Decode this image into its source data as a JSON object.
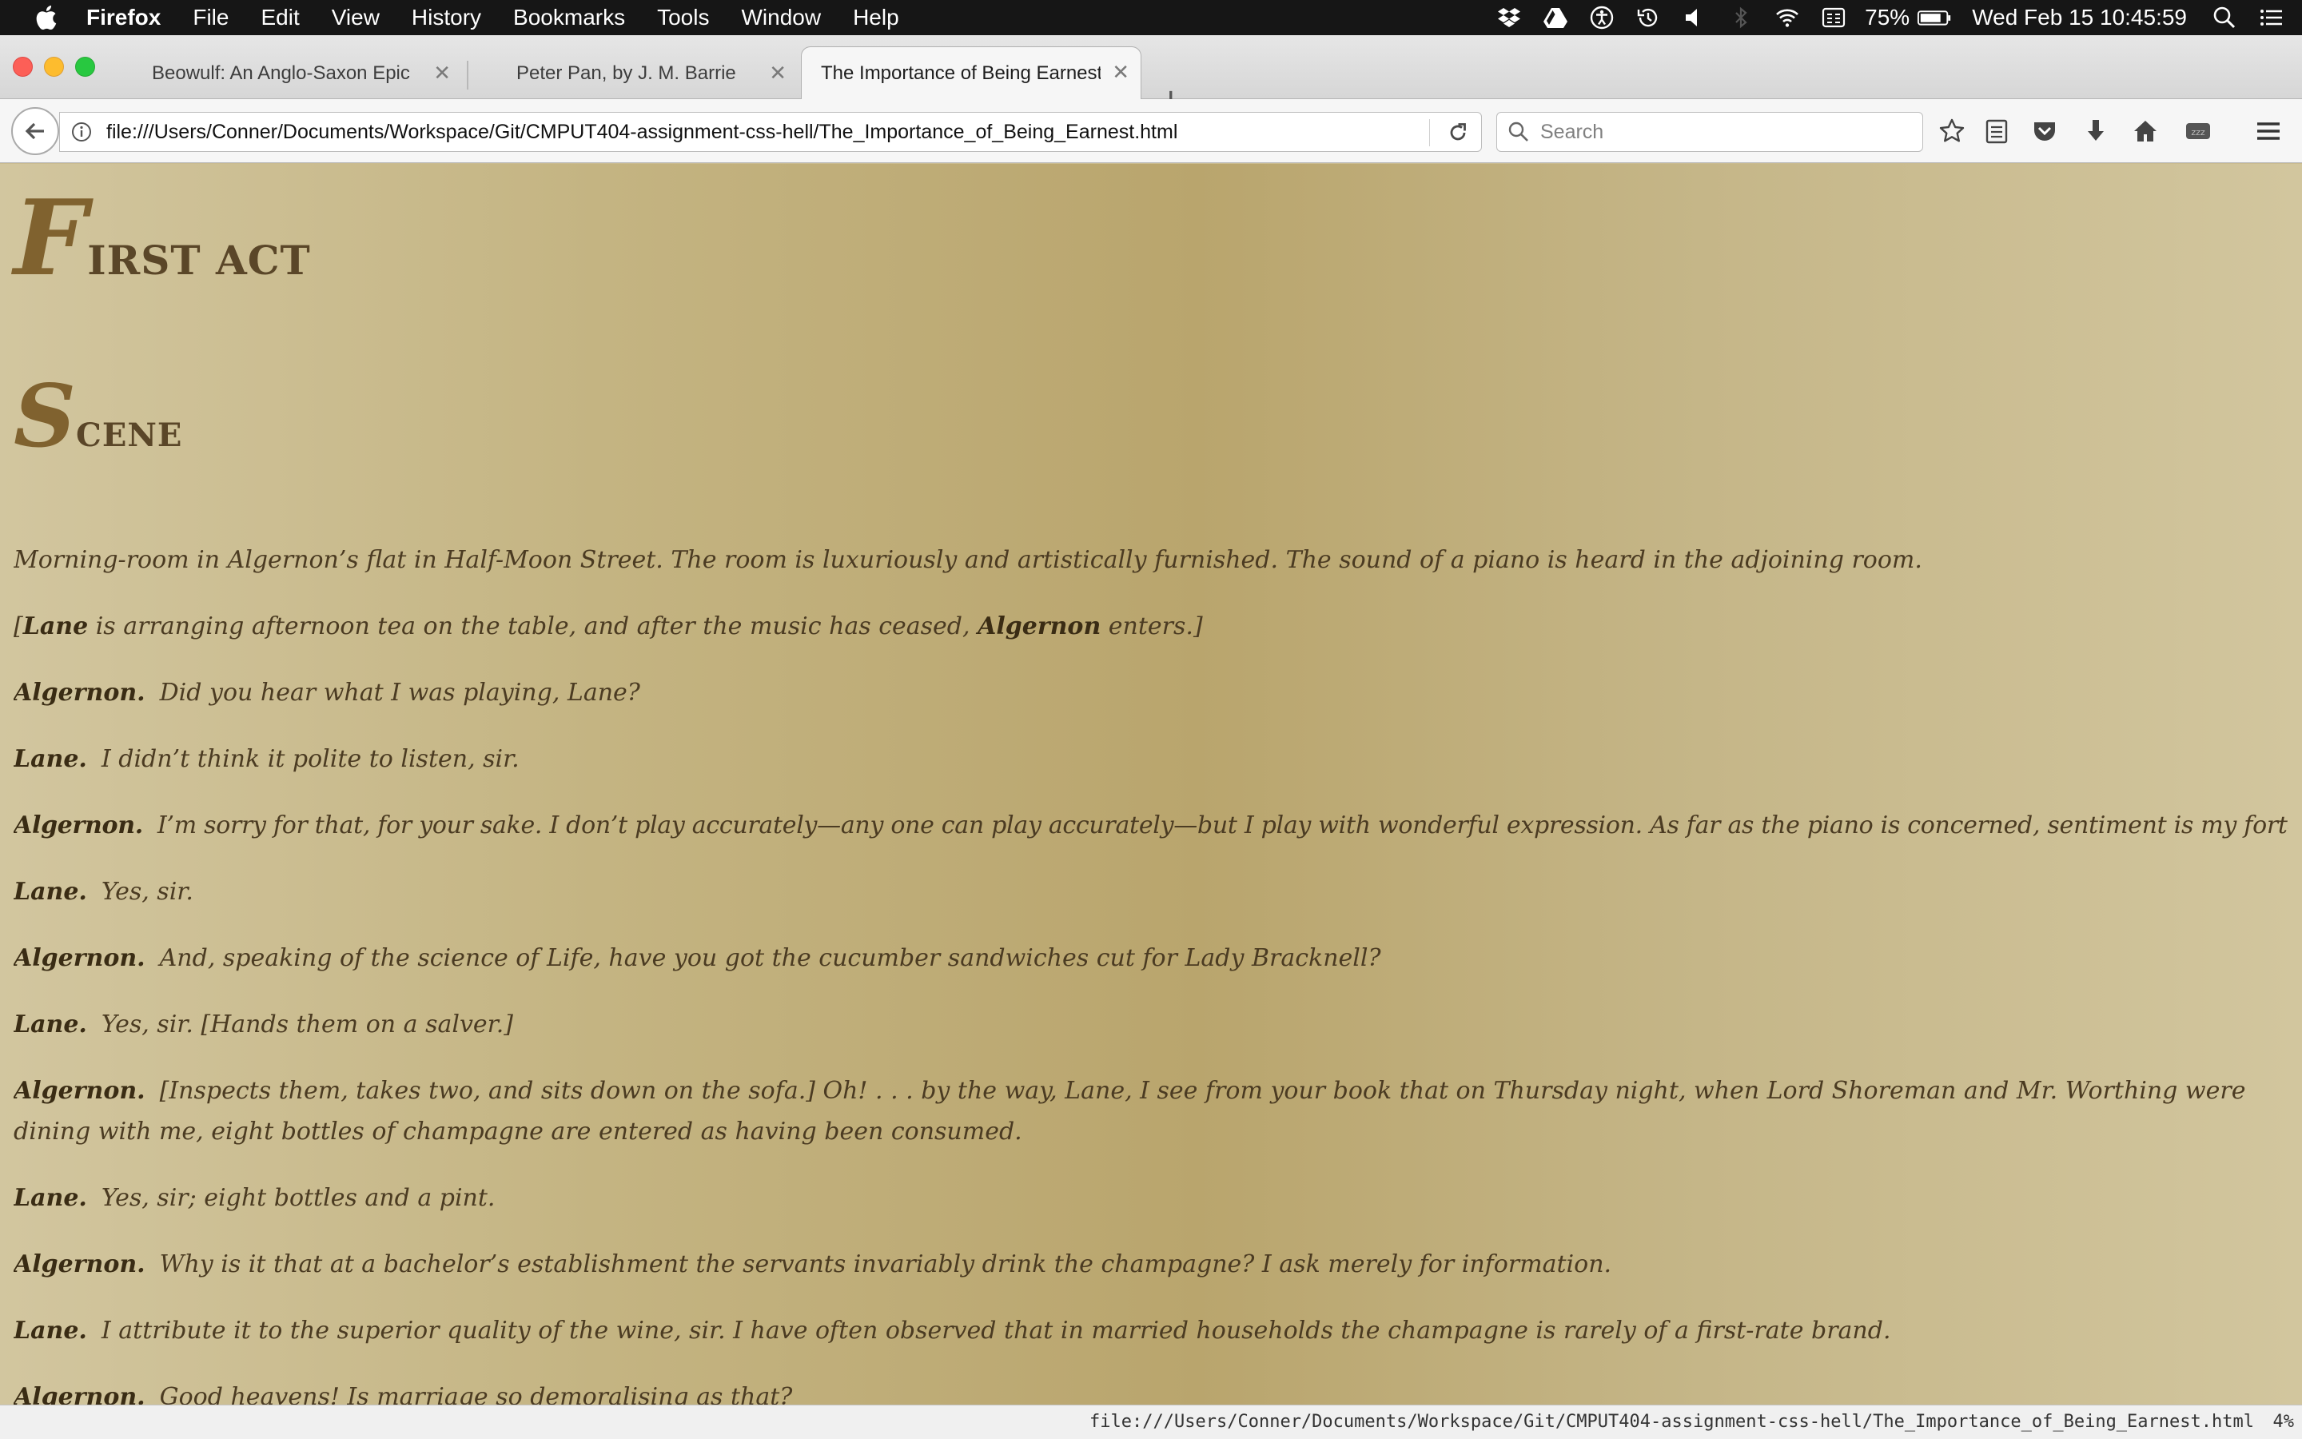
{
  "menubar": {
    "app_name": "Firefox",
    "items": [
      "File",
      "Edit",
      "View",
      "History",
      "Bookmarks",
      "Tools",
      "Window",
      "Help"
    ],
    "battery": "75%",
    "datetime": "Wed Feb 15  10:45:59"
  },
  "tabs": [
    {
      "title": "Beowulf: An Anglo-Saxon Epic ...",
      "active": false
    },
    {
      "title": "Peter Pan, by J. M. Barrie",
      "active": false
    },
    {
      "title": "The Importance of Being Earnest",
      "active": true
    }
  ],
  "toolbar": {
    "url": "file:///Users/Conner/Documents/Workspace/Git/CMPUT404-assignment-css-hell/The_Importance_of_Being_Earnest.html",
    "search_placeholder": "Search"
  },
  "page": {
    "act_initial": "F",
    "act_rest": "irst act",
    "scene_initial": "S",
    "scene_rest": "cene",
    "stage_direction": "Morning-room in Algernon’s flat in Half-Moon Street.  The room is luxuriously and artistically furnished.  The sound of a piano is heard in the adjoining room.",
    "entrance": {
      "open": "[",
      "name1": "Lane",
      "middle": " is arranging afternoon tea on the table, and after the music has ceased, ",
      "name2": "Algernon",
      "close": " enters.]"
    },
    "dialogue": [
      {
        "speaker": "Algernon.",
        "line": "Did you hear what I was playing, Lane?"
      },
      {
        "speaker": "Lane.",
        "line": "I didn’t think it polite to listen, sir."
      },
      {
        "speaker": "Algernon.",
        "line": "I’m sorry for that, for your sake.  I don’t play accurately—any one can play accurately—but I play with wonderful expression.  As far as the piano is concerned, sentiment is my forte.  I keep science for Life."
      },
      {
        "speaker": "Lane.",
        "line": "Yes, sir."
      },
      {
        "speaker": "Algernon.",
        "line": "And, speaking of the science of Life, have you got the cucumber sandwiches cut for Lady Bracknell?"
      },
      {
        "speaker": "Lane.",
        "line": "Yes, sir.  [Hands them on a salver.]"
      },
      {
        "speaker": "Algernon.",
        "line": "[Inspects them, takes two, and sits down on the sofa.]  Oh! . . . by the way, Lane, I see from your book that on Thursday night, when Lord Shoreman and Mr. Worthing were dining with me, eight bottles of champagne are entered as having been consumed."
      },
      {
        "speaker": "Lane.",
        "line": "Yes, sir; eight bottles and a pint."
      },
      {
        "speaker": "Algernon.",
        "line": "Why is it that at a bachelor’s establishment the servants invariably drink the champagne?  I ask merely for information."
      },
      {
        "speaker": "Lane.",
        "line": "I attribute it to the superior quality of the wine, sir.  I have often observed that in married households the champagne is rarely of a first-rate brand."
      },
      {
        "speaker": "Algernon.",
        "line": "Good heavens!  Is marriage so demoralising as that?"
      }
    ]
  },
  "statusbar": {
    "link_url": "file:///Users/Conner/Documents/Workspace/Git/CMPUT404-assignment-css-hell/The_Importance_of_Being_Earnest.html",
    "zoom": "4%"
  }
}
